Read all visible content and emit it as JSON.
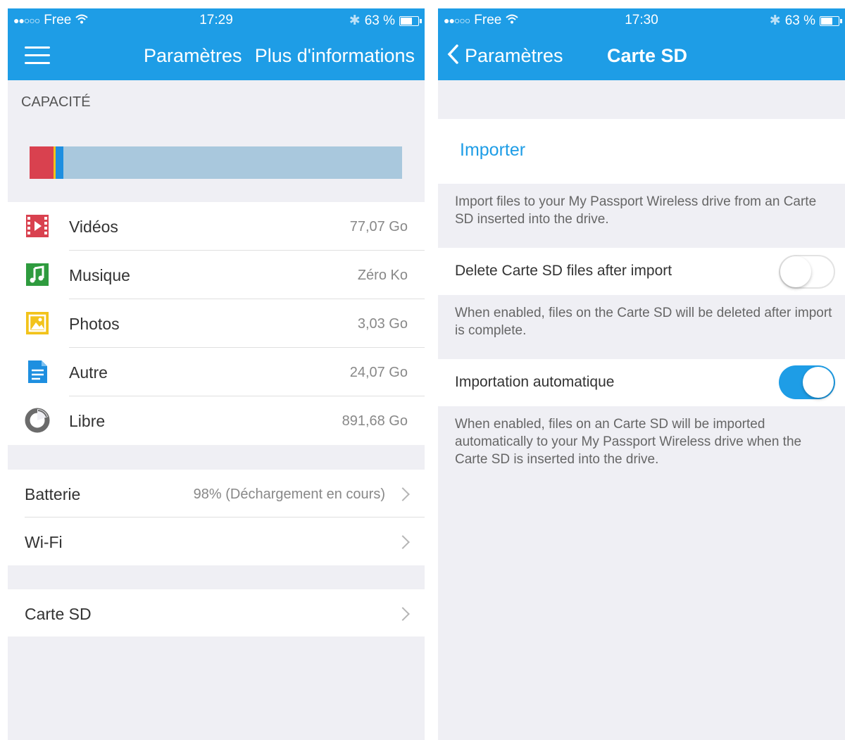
{
  "left": {
    "status": {
      "carrier": "Free",
      "time": "17:29",
      "battery": "63 %"
    },
    "nav": {
      "title": "Paramètres",
      "right_link": "Plus d'informations"
    },
    "capacity_header": "CAPACITÉ",
    "storage_items": [
      {
        "label": "Vidéos",
        "value": "77,07 Go",
        "icon": "video-icon"
      },
      {
        "label": "Musique",
        "value": "Zéro Ko",
        "icon": "music-icon"
      },
      {
        "label": "Photos",
        "value": "3,03 Go",
        "icon": "photo-icon"
      },
      {
        "label": "Autre",
        "value": "24,07 Go",
        "icon": "document-icon"
      },
      {
        "label": "Libre",
        "value": "891,68 Go",
        "icon": "pie-icon"
      }
    ],
    "settings": {
      "battery_label": "Batterie",
      "battery_value": "98% (Déchargement en cours)",
      "wifi_label": "Wi-Fi",
      "sdcard_label": "Carte SD"
    },
    "colors": {
      "video": "#d9414f",
      "music": "#2e9b3e",
      "photo": "#f2c31b",
      "doc": "#1e8fe0",
      "free": "#a9c8dd",
      "accent": "#1e9de6"
    }
  },
  "right": {
    "status": {
      "carrier": "Free",
      "time": "17:30",
      "battery": "63 %"
    },
    "nav": {
      "back_label": "Paramètres",
      "title": "Carte SD"
    },
    "import_label": "Importer",
    "import_desc": "Import files to your My Passport Wireless drive from an Carte SD inserted into the drive.",
    "delete_label": "Delete Carte SD files after import",
    "delete_desc": "When enabled, files on the Carte SD will be deleted after import is complete.",
    "delete_enabled": false,
    "auto_label": "Importation automatique",
    "auto_desc": "When enabled, files on an Carte SD will be imported automatically to your My Passport Wireless drive when the Carte SD is inserted into the drive.",
    "auto_enabled": true
  }
}
